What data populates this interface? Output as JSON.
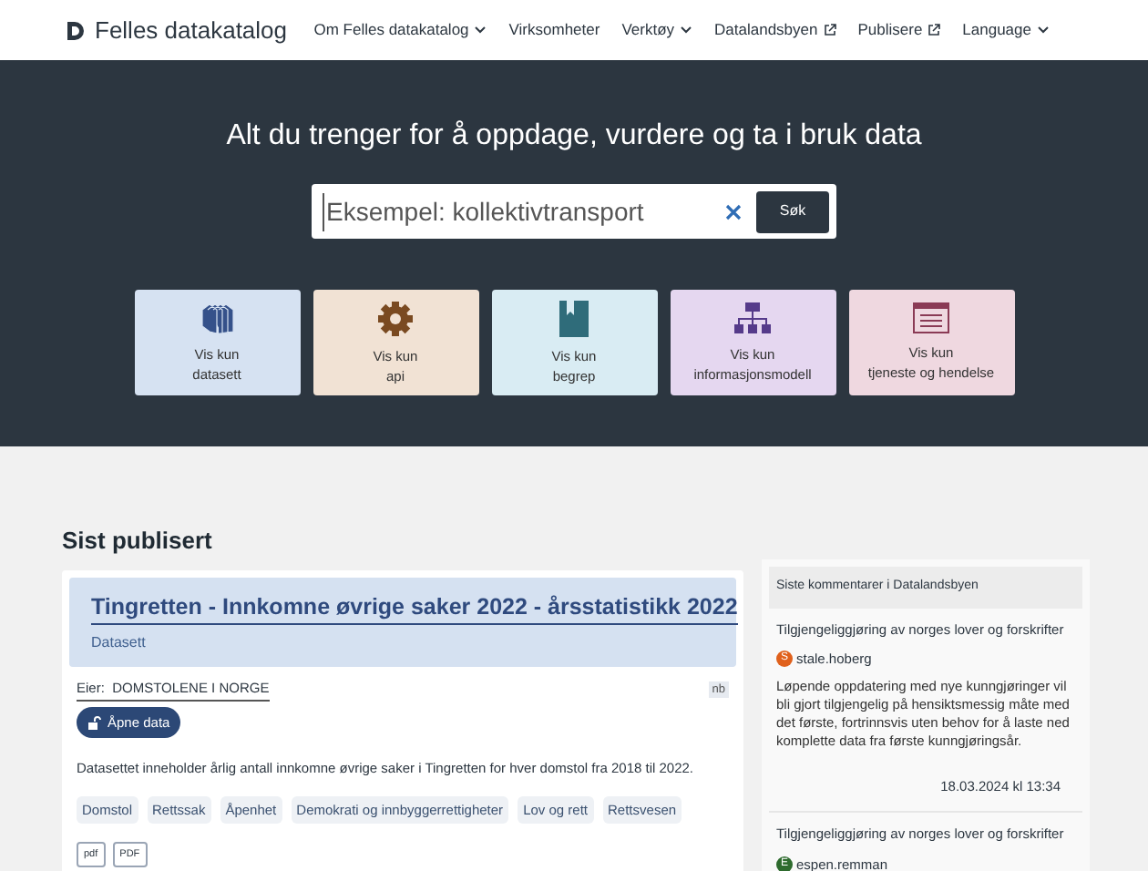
{
  "header": {
    "logo": "Felles datakatalog",
    "nav": [
      {
        "label": "Om Felles datakatalog",
        "kind": "dropdown"
      },
      {
        "label": "Virksomheter",
        "kind": "plain"
      },
      {
        "label": "Verktøy",
        "kind": "dropdown"
      },
      {
        "label": "Datalandsbyen",
        "kind": "external"
      },
      {
        "label": "Publisere",
        "kind": "external"
      },
      {
        "label": "Language",
        "kind": "dropdown"
      }
    ]
  },
  "hero": {
    "title": "Alt du trenger for å oppdage, vurdere og ta i bruk data",
    "search": {
      "placeholder": "Eksempel: kollektivtransport",
      "button": "Søk"
    },
    "filters": [
      {
        "kind": "datasett",
        "line1": "Vis kun",
        "line2": "datasett"
      },
      {
        "kind": "api",
        "line1": "Vis kun",
        "line2": "api"
      },
      {
        "kind": "begrep",
        "line1": "Vis kun",
        "line2": "begrep"
      },
      {
        "kind": "informasjonsmodell",
        "line1": "Vis kun",
        "line2": "informasjonsmodell"
      },
      {
        "kind": "tjeneste",
        "line1": "Vis kun",
        "line2": "tjeneste og hendelse"
      }
    ]
  },
  "latest": {
    "heading": "Sist publisert",
    "card": {
      "title": "Tingretten - Innkomne øvrige saker 2022 - årsstatistikk 2022",
      "type": "Datasett",
      "owner": "Eier:  DOMSTOLENE I NORGE",
      "language": "nb",
      "access": "Åpne data",
      "description": "Datasettet inneholder årlig antall innkomne øvrige saker i Tingretten for hver domstol fra 2018 til 2022.",
      "themes": [
        "Domstol",
        "Rettssak",
        "Åpenhet",
        "Demokrati og innbyggerrettigheter",
        "Lov og rett",
        "Rettsvesen"
      ],
      "formats": [
        "pdf",
        "PDF"
      ]
    }
  },
  "comments": {
    "heading": "Siste kommentarer i Datalandsbyen",
    "items": [
      {
        "topic": "Tilgjengeliggjøring av norges lover og forskrifter",
        "initial": "S",
        "user": "stale.hoberg",
        "color": "#e0611c",
        "text": "Løpende oppdatering med nye kunngjøringer vil bli gjort tilgjengelig på hensiktsmessig måte med det første, fortrinnsvis uten behov for å laste ned komplette data fra første kunngjøringsår.",
        "date": "18.03.2024 kl 13:34"
      },
      {
        "topic": "Tilgjengeliggjøring av norges lover og forskrifter",
        "initial": "E",
        "user": "espen.remman",
        "color": "#2e6b2e"
      }
    ]
  }
}
